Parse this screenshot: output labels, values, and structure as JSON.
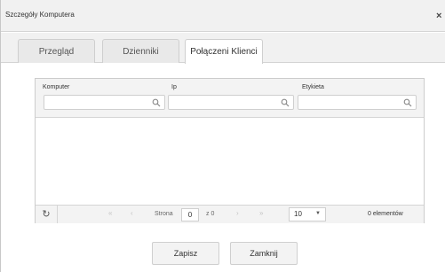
{
  "dialog": {
    "title": "Szczegóły Komputera",
    "close_glyph": "×"
  },
  "tabs": [
    {
      "label": "Przegląd",
      "active": false
    },
    {
      "label": "Dzienniki",
      "active": false
    },
    {
      "label": "Połączeni Klienci",
      "active": true
    }
  ],
  "grid": {
    "columns": [
      {
        "label": "Komputer",
        "filter_value": ""
      },
      {
        "label": "Ip",
        "filter_value": ""
      },
      {
        "label": "Etykieta",
        "filter_value": ""
      }
    ],
    "rows": []
  },
  "pager": {
    "refresh_glyph": "↻",
    "first": "«",
    "prev": "‹",
    "next": "›",
    "last": "»",
    "page_label": "Strona",
    "page_value": "0",
    "of_label": "z 0",
    "page_size": "10",
    "size_caret": "▼",
    "items_text": "0 elementów"
  },
  "buttons": {
    "save": "Zapisz",
    "close": "Zamknij"
  },
  "colors": {
    "header_bg": "#f1f1f1",
    "border": "#cccccc",
    "active_tab_bg": "#ffffff"
  }
}
